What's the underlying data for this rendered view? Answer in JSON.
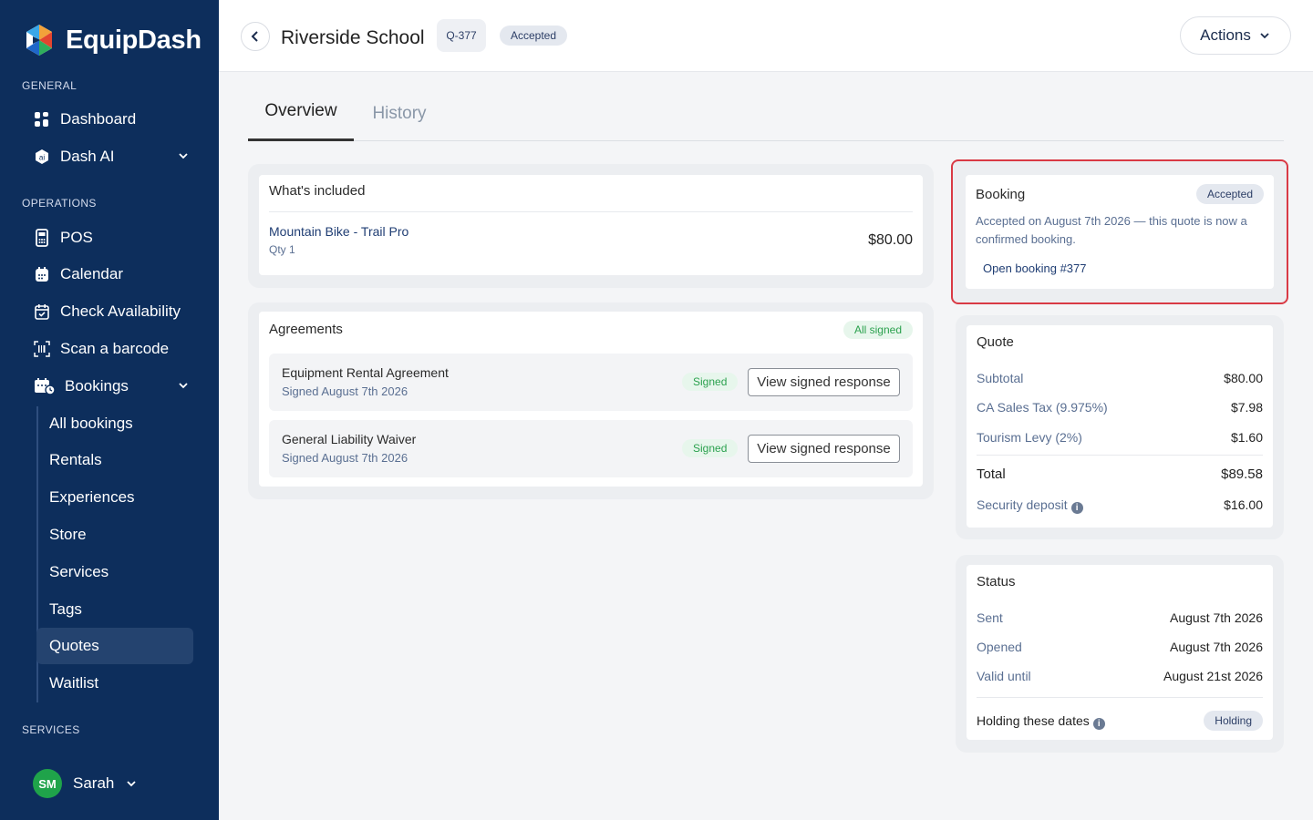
{
  "sidebar": {
    "brand": "EquipDash",
    "sections": {
      "general": "GENERAL",
      "operations": "OPERATIONS",
      "services": "SERVICES"
    },
    "general_items": [
      {
        "label": "Dashboard",
        "icon": "grid-icon"
      },
      {
        "label": "Dash AI",
        "icon": "shield-icon"
      }
    ],
    "operations_items": [
      {
        "label": "POS",
        "icon": "pos-terminal-icon"
      },
      {
        "label": "Calendar",
        "icon": "calendar-icon"
      },
      {
        "label": "Check Availability",
        "icon": "calendar-check-icon"
      },
      {
        "label": "Scan a barcode",
        "icon": "barcode-scan-icon"
      },
      {
        "label": "Bookings",
        "icon": "bookings-icon"
      }
    ],
    "bookings_sub": [
      "All bookings",
      "Rentals",
      "Experiences",
      "Store",
      "Services",
      "Tags",
      "Quotes",
      "Waitlist"
    ],
    "active_sub": "Quotes",
    "user": {
      "initials": "SM",
      "name": "Sarah"
    }
  },
  "header": {
    "title": "Riverside School",
    "quote_id": "Q-377",
    "status": "Accepted",
    "actions_label": "Actions"
  },
  "tabs": [
    "Overview",
    "History"
  ],
  "included": {
    "title": "What's included",
    "item_name": "Mountain Bike - Trail Pro",
    "item_qty": "Qty 1",
    "item_price": "$80.00"
  },
  "agreements": {
    "title": "Agreements",
    "badge": "All signed",
    "items": [
      {
        "name": "Equipment Rental Agreement",
        "date": "Signed August 7th 2026",
        "status": "Signed",
        "button": "View signed response"
      },
      {
        "name": "General Liability Waiver",
        "date": "Signed August 7th 2026",
        "status": "Signed",
        "button": "View signed response"
      }
    ]
  },
  "booking": {
    "title": "Booking",
    "badge": "Accepted",
    "message": "Accepted on August 7th 2026 — this quote is now a confirmed booking.",
    "link": "Open booking #377"
  },
  "quote": {
    "title": "Quote",
    "rows": [
      {
        "label": "Subtotal",
        "value": "$80.00"
      },
      {
        "label": "CA Sales Tax (9.975%)",
        "value": "$7.98"
      },
      {
        "label": "Tourism Levy (2%)",
        "value": "$1.60"
      }
    ],
    "total_label": "Total",
    "total_value": "$89.58",
    "deposit_label": "Security deposit",
    "deposit_value": "$16.00"
  },
  "status": {
    "title": "Status",
    "rows": [
      {
        "label": "Sent",
        "value": "August 7th 2026"
      },
      {
        "label": "Opened",
        "value": "August 7th 2026"
      },
      {
        "label": "Valid until",
        "value": "August 21st 2026"
      }
    ],
    "holding_label": "Holding these dates",
    "holding_badge": "Holding"
  },
  "colors": {
    "sidebar": "#0d2e5c",
    "highlight": "#d93a45",
    "accent_green": "#2ba14e"
  }
}
